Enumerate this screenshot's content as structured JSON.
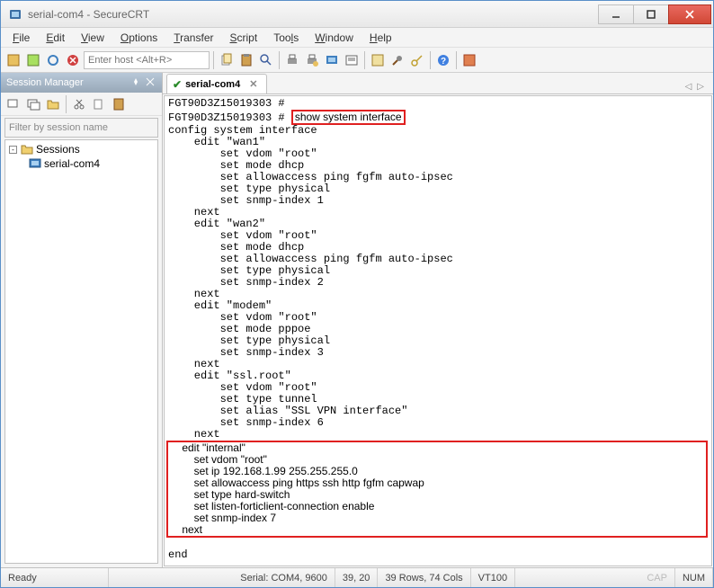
{
  "window": {
    "title": "serial-com4 - SecureCRT"
  },
  "menu": {
    "file": "File",
    "edit": "Edit",
    "view": "View",
    "options": "Options",
    "transfer": "Transfer",
    "script": "Script",
    "tools": "Tools",
    "window": "Window",
    "help": "Help"
  },
  "toolbar": {
    "host_placeholder": "Enter host <Alt+R>"
  },
  "session_manager": {
    "title": "Session Manager",
    "filter_placeholder": "Filter by session name",
    "root": "Sessions",
    "item": "serial-com4"
  },
  "tab": {
    "label": "serial-com4"
  },
  "terminal": {
    "prompt": "FGT90D3Z15019303 # ",
    "cmd": "show system interface",
    "lines": [
      "config system interface",
      "    edit \"wan1\"",
      "        set vdom \"root\"",
      "        set mode dhcp",
      "        set allowaccess ping fgfm auto-ipsec",
      "        set type physical",
      "        set snmp-index 1",
      "    next",
      "    edit \"wan2\"",
      "        set vdom \"root\"",
      "        set mode dhcp",
      "        set allowaccess ping fgfm auto-ipsec",
      "        set type physical",
      "        set snmp-index 2",
      "    next",
      "    edit \"modem\"",
      "        set vdom \"root\"",
      "        set mode pppoe",
      "        set type physical",
      "        set snmp-index 3",
      "    next",
      "    edit \"ssl.root\"",
      "        set vdom \"root\"",
      "        set type tunnel",
      "        set alias \"SSL VPN interface\"",
      "        set snmp-index 6",
      "    next"
    ],
    "block": [
      "    edit \"internal\"",
      "        set vdom \"root\"",
      "        set ip 192.168.1.99 255.255.255.0",
      "        set allowaccess ping https ssh http fgfm capwap",
      "        set type hard-switch",
      "        set listen-forticlient-connection enable",
      "        set snmp-index 7",
      "    next                                                           "
    ],
    "end": "end"
  },
  "status": {
    "ready": "Ready",
    "serial": "Serial: COM4, 9600",
    "pos": "39,  20",
    "dims": "39 Rows, 74 Cols",
    "emu": "VT100",
    "cap": "CAP",
    "num": "NUM"
  }
}
